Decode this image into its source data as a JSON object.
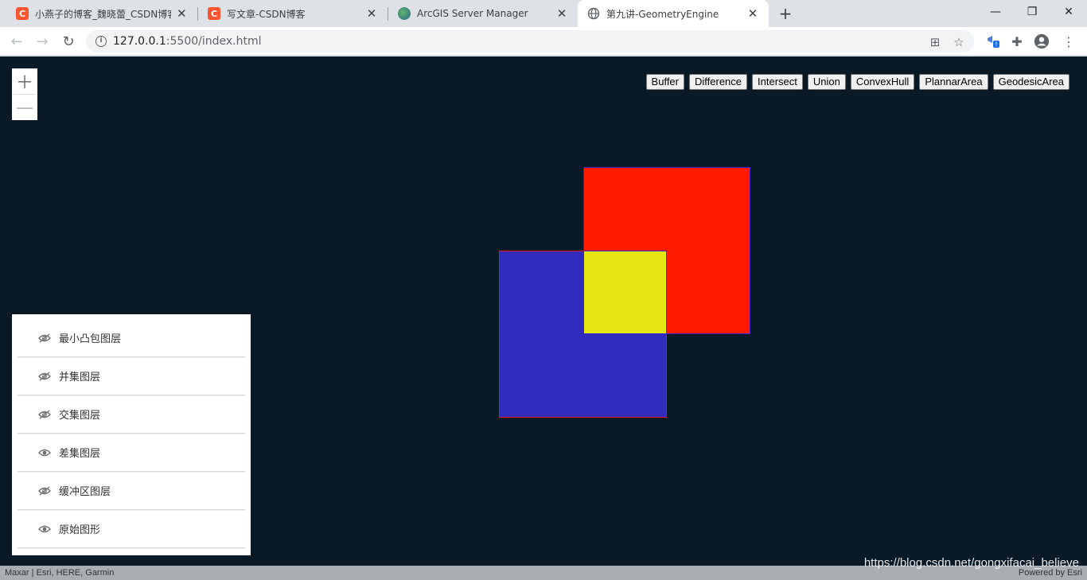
{
  "browser": {
    "tabs": [
      {
        "title": "小燕子的博客_魏晓蕾_CSDN博客",
        "icon": "csdn-icon",
        "active": false
      },
      {
        "title": "写文章-CSDN博客",
        "icon": "csdn-icon",
        "active": false
      },
      {
        "title": "ArcGIS Server Manager",
        "icon": "arcgis-icon",
        "active": false
      },
      {
        "title": "第九讲-GeometryEngine",
        "icon": "globe-icon",
        "active": true
      }
    ],
    "url_host": "127.0.0.1",
    "url_rest": ":5500/index.html"
  },
  "map": {
    "buttons": [
      "Buffer",
      "Difference",
      "Intersect",
      "Union",
      "ConvexHull",
      "PlannarArea",
      "GeodesicArea"
    ],
    "layers": [
      {
        "label": "最小凸包图层",
        "visible": false
      },
      {
        "label": "并集图层",
        "visible": false
      },
      {
        "label": "交集图层",
        "visible": false
      },
      {
        "label": "差集图层",
        "visible": true
      },
      {
        "label": "缓冲区图层",
        "visible": false
      },
      {
        "label": "原始图形",
        "visible": true
      }
    ],
    "attribution_left": "Maxar | Esri, HERE, Garmin",
    "attribution_right": "Powered by Esri",
    "watermark": "https://blog.csdn.net/gongxifacai_believe",
    "colors": {
      "background": "#091926",
      "blue_polygon": "#312cbd",
      "red_polygon": "#ff1a00",
      "intersection_polygon": "#e8e716"
    }
  }
}
